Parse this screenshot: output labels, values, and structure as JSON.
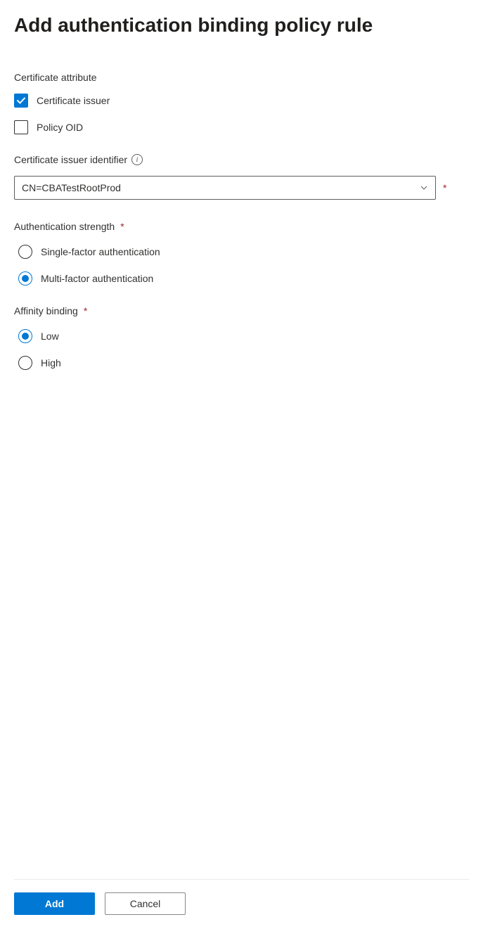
{
  "title": "Add authentication binding policy rule",
  "certAttribute": {
    "label": "Certificate attribute",
    "options": [
      {
        "label": "Certificate issuer",
        "checked": true
      },
      {
        "label": "Policy OID",
        "checked": false
      }
    ]
  },
  "issuerIdentifier": {
    "label": "Certificate issuer identifier",
    "required": true,
    "value": "CN=CBATestRootProd"
  },
  "authStrength": {
    "label": "Authentication strength",
    "required": true,
    "options": [
      {
        "label": "Single-factor authentication",
        "selected": false
      },
      {
        "label": "Multi-factor authentication",
        "selected": true
      }
    ]
  },
  "affinityBinding": {
    "label": "Affinity binding",
    "required": true,
    "options": [
      {
        "label": "Low",
        "selected": true
      },
      {
        "label": "High",
        "selected": false
      }
    ]
  },
  "footer": {
    "primary": "Add",
    "secondary": "Cancel"
  }
}
